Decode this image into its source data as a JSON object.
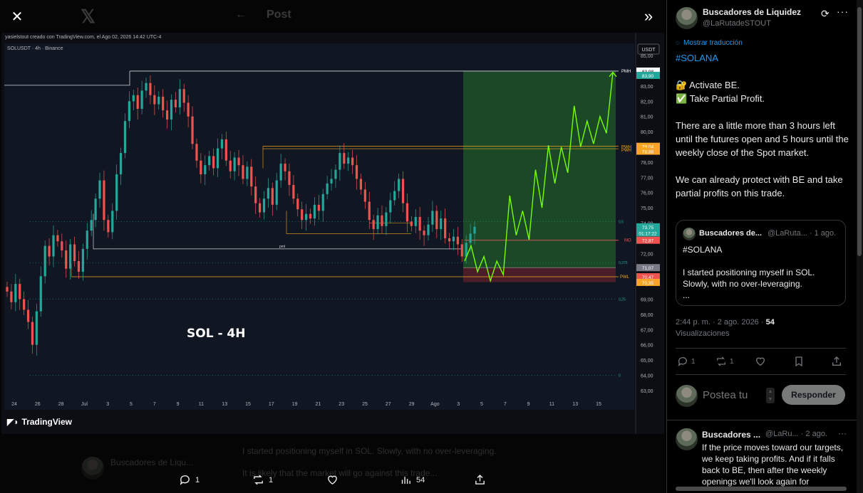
{
  "viewer": {
    "ghost_title": "Post",
    "ghost_author": "Buscadores de Liqu...",
    "ghost_line1": "I started positioning myself in SOL. Slowly, with no over-leveraging.",
    "ghost_line2": "It is likely that the market will go against this trade..."
  },
  "chart": {
    "credit": "yasielstout creado con TradingView.com, el Ago 02, 2026 14:42 UTC-4",
    "symbol": "SOLUSDT · 4h · Binance",
    "currency": "USDT",
    "caption": "SOL - 4H",
    "watermark": "TradingView",
    "accent_up": "#26a69a",
    "accent_down": "#ef5350",
    "projection_color": "#76ff03"
  },
  "chart_data": {
    "type": "candlestick",
    "title": "SOL - 4H",
    "symbol": "SOLUSDT",
    "timeframe": "4h",
    "exchange": "Binance",
    "y_ticks": [
      85,
      84,
      83,
      82,
      81,
      80,
      79,
      78,
      77,
      76,
      75,
      74,
      73,
      72,
      71,
      70,
      69,
      68,
      67,
      66,
      65,
      64,
      63
    ],
    "y_tick_labels": [
      "85,00",
      "84,00",
      "83,00",
      "82,00",
      "81,00",
      "80,00",
      "79,00",
      "78,00",
      "77,00",
      "76,00",
      "75,00",
      "74,00",
      "73,00",
      "72,00",
      "71,00",
      "70,00",
      "69,00",
      "68,00",
      "67,00",
      "66,00",
      "65,00",
      "64,00",
      "63,00"
    ],
    "ylim": [
      62.2,
      85.8
    ],
    "x_ticks": [
      "24",
      "26",
      "28",
      "Jul",
      "3",
      "5",
      "7",
      "9",
      "11",
      "13",
      "15",
      "17",
      "19",
      "21",
      "23",
      "25",
      "27",
      "29",
      "Ago",
      "3",
      "5",
      "7",
      "9",
      "11",
      "13",
      "15"
    ],
    "levels": [
      {
        "label": "PMH",
        "value": 83.98
      },
      {
        "label": "PWH",
        "value": 79.04
      },
      {
        "label": "PWH",
        "value": 78.88
      },
      {
        "label": "MO",
        "value": 72.87
      },
      {
        "label": "PWL",
        "value": 70.47
      },
      {
        "label": "PWL",
        "value": 70.35
      },
      {
        "label": "pml",
        "value": 72.3
      }
    ],
    "price_tags": [
      {
        "label": "83,98",
        "value": 83.98,
        "color": "#ffffff"
      },
      {
        "label": "83,90",
        "value": 83.7,
        "color": "#26a69a"
      },
      {
        "label": "79,04",
        "value": 79.04,
        "color": "#f5a623"
      },
      {
        "label": "78,88",
        "value": 78.72,
        "color": "#f5a623"
      },
      {
        "label": "73,75",
        "value": 73.75,
        "color": "#26a69a"
      },
      {
        "label": "01:17:22",
        "value": 73.35,
        "color": "#26a69a"
      },
      {
        "label": "72,87",
        "value": 72.87,
        "color": "#ef5350"
      },
      {
        "label": "71,07",
        "value": 71.07,
        "color": "#787b86"
      },
      {
        "label": "70,47",
        "value": 70.47,
        "color": "#ef5350"
      },
      {
        "label": "70,35",
        "value": 70.1,
        "color": "#f5a623"
      }
    ],
    "fib_labels": [
      {
        "label": "0,5",
        "value": 74.1
      },
      {
        "label": "0,375",
        "value": 71.4
      },
      {
        "label": "0,25",
        "value": 69.0
      },
      {
        "label": "0",
        "value": 64.0
      }
    ],
    "position": {
      "entry": 71.07,
      "target": 83.98,
      "stop": 70.35
    },
    "projection": [
      71.5,
      72.5,
      70.8,
      71.8,
      70.2,
      71.5,
      70.6,
      75.8,
      73.2,
      74.8,
      72.9,
      77.5,
      75.0,
      79.1,
      76.6,
      79.0,
      77.3,
      81.7,
      79.0,
      80.7,
      79.2,
      81.0,
      79.9,
      83.9
    ],
    "candles_close": [
      69.5,
      68.8,
      70.0,
      69.0,
      68.3,
      67.5,
      66.0,
      68.2,
      70.5,
      72.5,
      71.8,
      73.2,
      72.8,
      72.2,
      71.0,
      72.6,
      71.5,
      70.8,
      72.3,
      73.5,
      74.2,
      75.6,
      76.8,
      74.2,
      73.4,
      74.8,
      77.2,
      78.6,
      80.7,
      82.0,
      82.4,
      81.5,
      82.7,
      83.2,
      82.4,
      81.8,
      82.3,
      81.4,
      80.8,
      82.1,
      81.6,
      82.8,
      81.9,
      81.0,
      79.2,
      78.1,
      77.2,
      77.8,
      78.4,
      77.6,
      78.9,
      79.5,
      78.1,
      77.4,
      78.3,
      77.8,
      76.9,
      77.7,
      76.4,
      75.3,
      74.7,
      75.6,
      76.3,
      75.2,
      76.8,
      77.9,
      77.4,
      76.5,
      75.6,
      74.9,
      74.2,
      74.6,
      74.3,
      75.2,
      74.8,
      75.9,
      76.6,
      76.9,
      77.5,
      78.6,
      77.9,
      78.3,
      77.8,
      76.9,
      76.2,
      75.4,
      74.2,
      73.6,
      74.5,
      73.8,
      74.7,
      75.5,
      76.1,
      76.9,
      75.3,
      74.1,
      73.8,
      74.4,
      73.5,
      73.2,
      73.9,
      74.8,
      73.6,
      74.3,
      73.0,
      72.8,
      73.1,
      72.6,
      71.8,
      72.7,
      73.3,
      73.75
    ]
  },
  "tweet": {
    "author_name": "Buscadores de Liquidez",
    "author_handle": "@LaRutadeSTOUT",
    "translate_label": "Mostrar traducción",
    "hashtag": "#SOLANA",
    "line_activate": "🔐 Activate BE.",
    "line_partial": "✅ Take Partial Profit.",
    "paragraph1": "There are a little more than 3 hours left until the futures open and 5 hours until the weekly close of the Spot market.",
    "paragraph2": "We can already protect with BE and take partial profits on this trade.",
    "timestamp": "2:44 p. m. · 2 ago. 2026 · ",
    "views_count": "54",
    "views_label": "Visualizaciones"
  },
  "quote": {
    "name": "Buscadores de...",
    "handle": "@LaRuta... · 1 ago.",
    "hashtag": "#SOLANA",
    "body": "I started positioning myself in SOL. Slowly, with no over-leveraging.",
    "ellipsis": "..."
  },
  "panel_actions": {
    "replies": "1",
    "reposts": "1"
  },
  "viewer_actions": {
    "replies": "1",
    "reposts": "1",
    "views": "54"
  },
  "composer": {
    "placeholder": "Postea tu",
    "button": "Responder"
  },
  "reply": {
    "name": "Buscadores ...",
    "handle": "@LaRu... · 2 ago.",
    "more": "···",
    "body": "If the price moves toward our targets, we keep taking profits. And if it falls back to BE, then after the weekly openings we'll look again for"
  }
}
